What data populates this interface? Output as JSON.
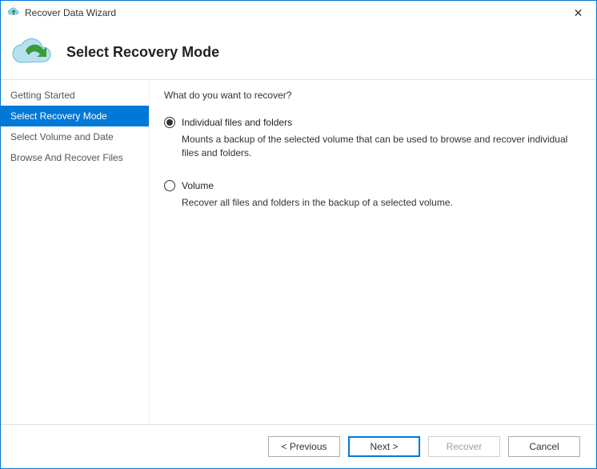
{
  "window": {
    "title": "Recover Data Wizard",
    "close_label": "✕"
  },
  "header": {
    "title": "Select Recovery Mode"
  },
  "sidebar": {
    "items": [
      {
        "label": "Getting Started"
      },
      {
        "label": "Select Recovery Mode"
      },
      {
        "label": "Select Volume and Date"
      },
      {
        "label": "Browse And Recover Files"
      }
    ],
    "active_index": 1
  },
  "content": {
    "question": "What do you want to recover?",
    "options": [
      {
        "label": "Individual files and folders",
        "description": "Mounts a backup of the selected volume that can be used to browse and recover individual files and folders.",
        "selected": true
      },
      {
        "label": "Volume",
        "description": "Recover all files and folders in the backup of a selected volume.",
        "selected": false
      }
    ]
  },
  "footer": {
    "previous": "< Previous",
    "next": "Next >",
    "recover": "Recover",
    "cancel": "Cancel"
  }
}
